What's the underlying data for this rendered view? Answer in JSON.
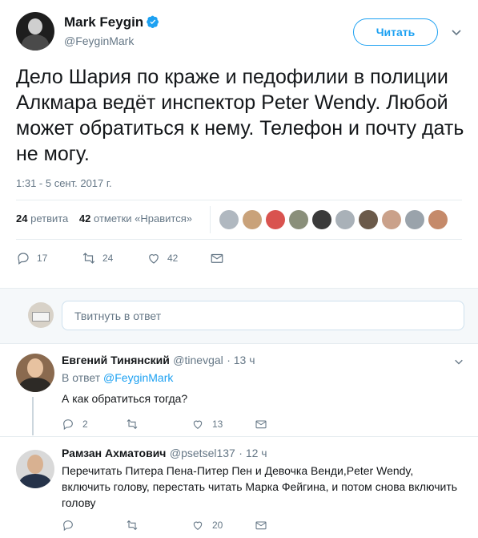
{
  "author": {
    "name": "Mark Feygin",
    "handle": "@FeyginMark",
    "verified_icon": "verified-badge-icon"
  },
  "follow_button": {
    "label": "Читать"
  },
  "tweet": {
    "text": "Дело Шария по краже и педофилии в полиции Алкмара ведёт инспектор Peter Wendy. Любой может обратиться к нему. Телефон и почту дать не могу.",
    "timestamp": "1:31 - 5 сент. 2017 г."
  },
  "stats": {
    "retweets_count": "24",
    "retweets_label": "ретвита",
    "likes_count": "42",
    "likes_label": "отметки «Нравится»"
  },
  "likers": [
    {
      "color": "#b0b8c0"
    },
    {
      "color": "#c9a27a"
    },
    {
      "color": "#d9534f"
    },
    {
      "color": "#8a8f7a"
    },
    {
      "color": "#3a3a3a"
    },
    {
      "color": "#a9b1b8"
    },
    {
      "color": "#6b5a4a"
    },
    {
      "color": "#caa18a"
    },
    {
      "color": "#9aa3ab"
    },
    {
      "color": "#c58a6a"
    }
  ],
  "actions": {
    "replies": "17",
    "retweets": "24",
    "likes": "42"
  },
  "reply_box": {
    "placeholder": "Твитнуть в ответ"
  },
  "replies": [
    {
      "name": "Евгений Тинянский",
      "handle": "@tinevgal",
      "time": "· 13 ч",
      "in_reply_prefix": "В ответ",
      "in_reply_to": "@FeyginMark",
      "text": "А как обратиться тогда?",
      "replies": "2",
      "retweets": "",
      "likes": "13"
    },
    {
      "name": "Рамзан Ахматович",
      "handle": "@psetsel137",
      "time": "· 12 ч",
      "text": "Перечитать Питера Пена-Питер Пен и Девочка Венди,Peter Wendy, включить голову, перестать читать Марка Фейгина, и потом снова включить голову",
      "replies": "",
      "retweets": "",
      "likes": "20"
    }
  ],
  "colors": {
    "accent": "#1da1f2",
    "secondary_text": "#657786",
    "primary_text": "#14171a",
    "divider": "#e6ecf0"
  }
}
